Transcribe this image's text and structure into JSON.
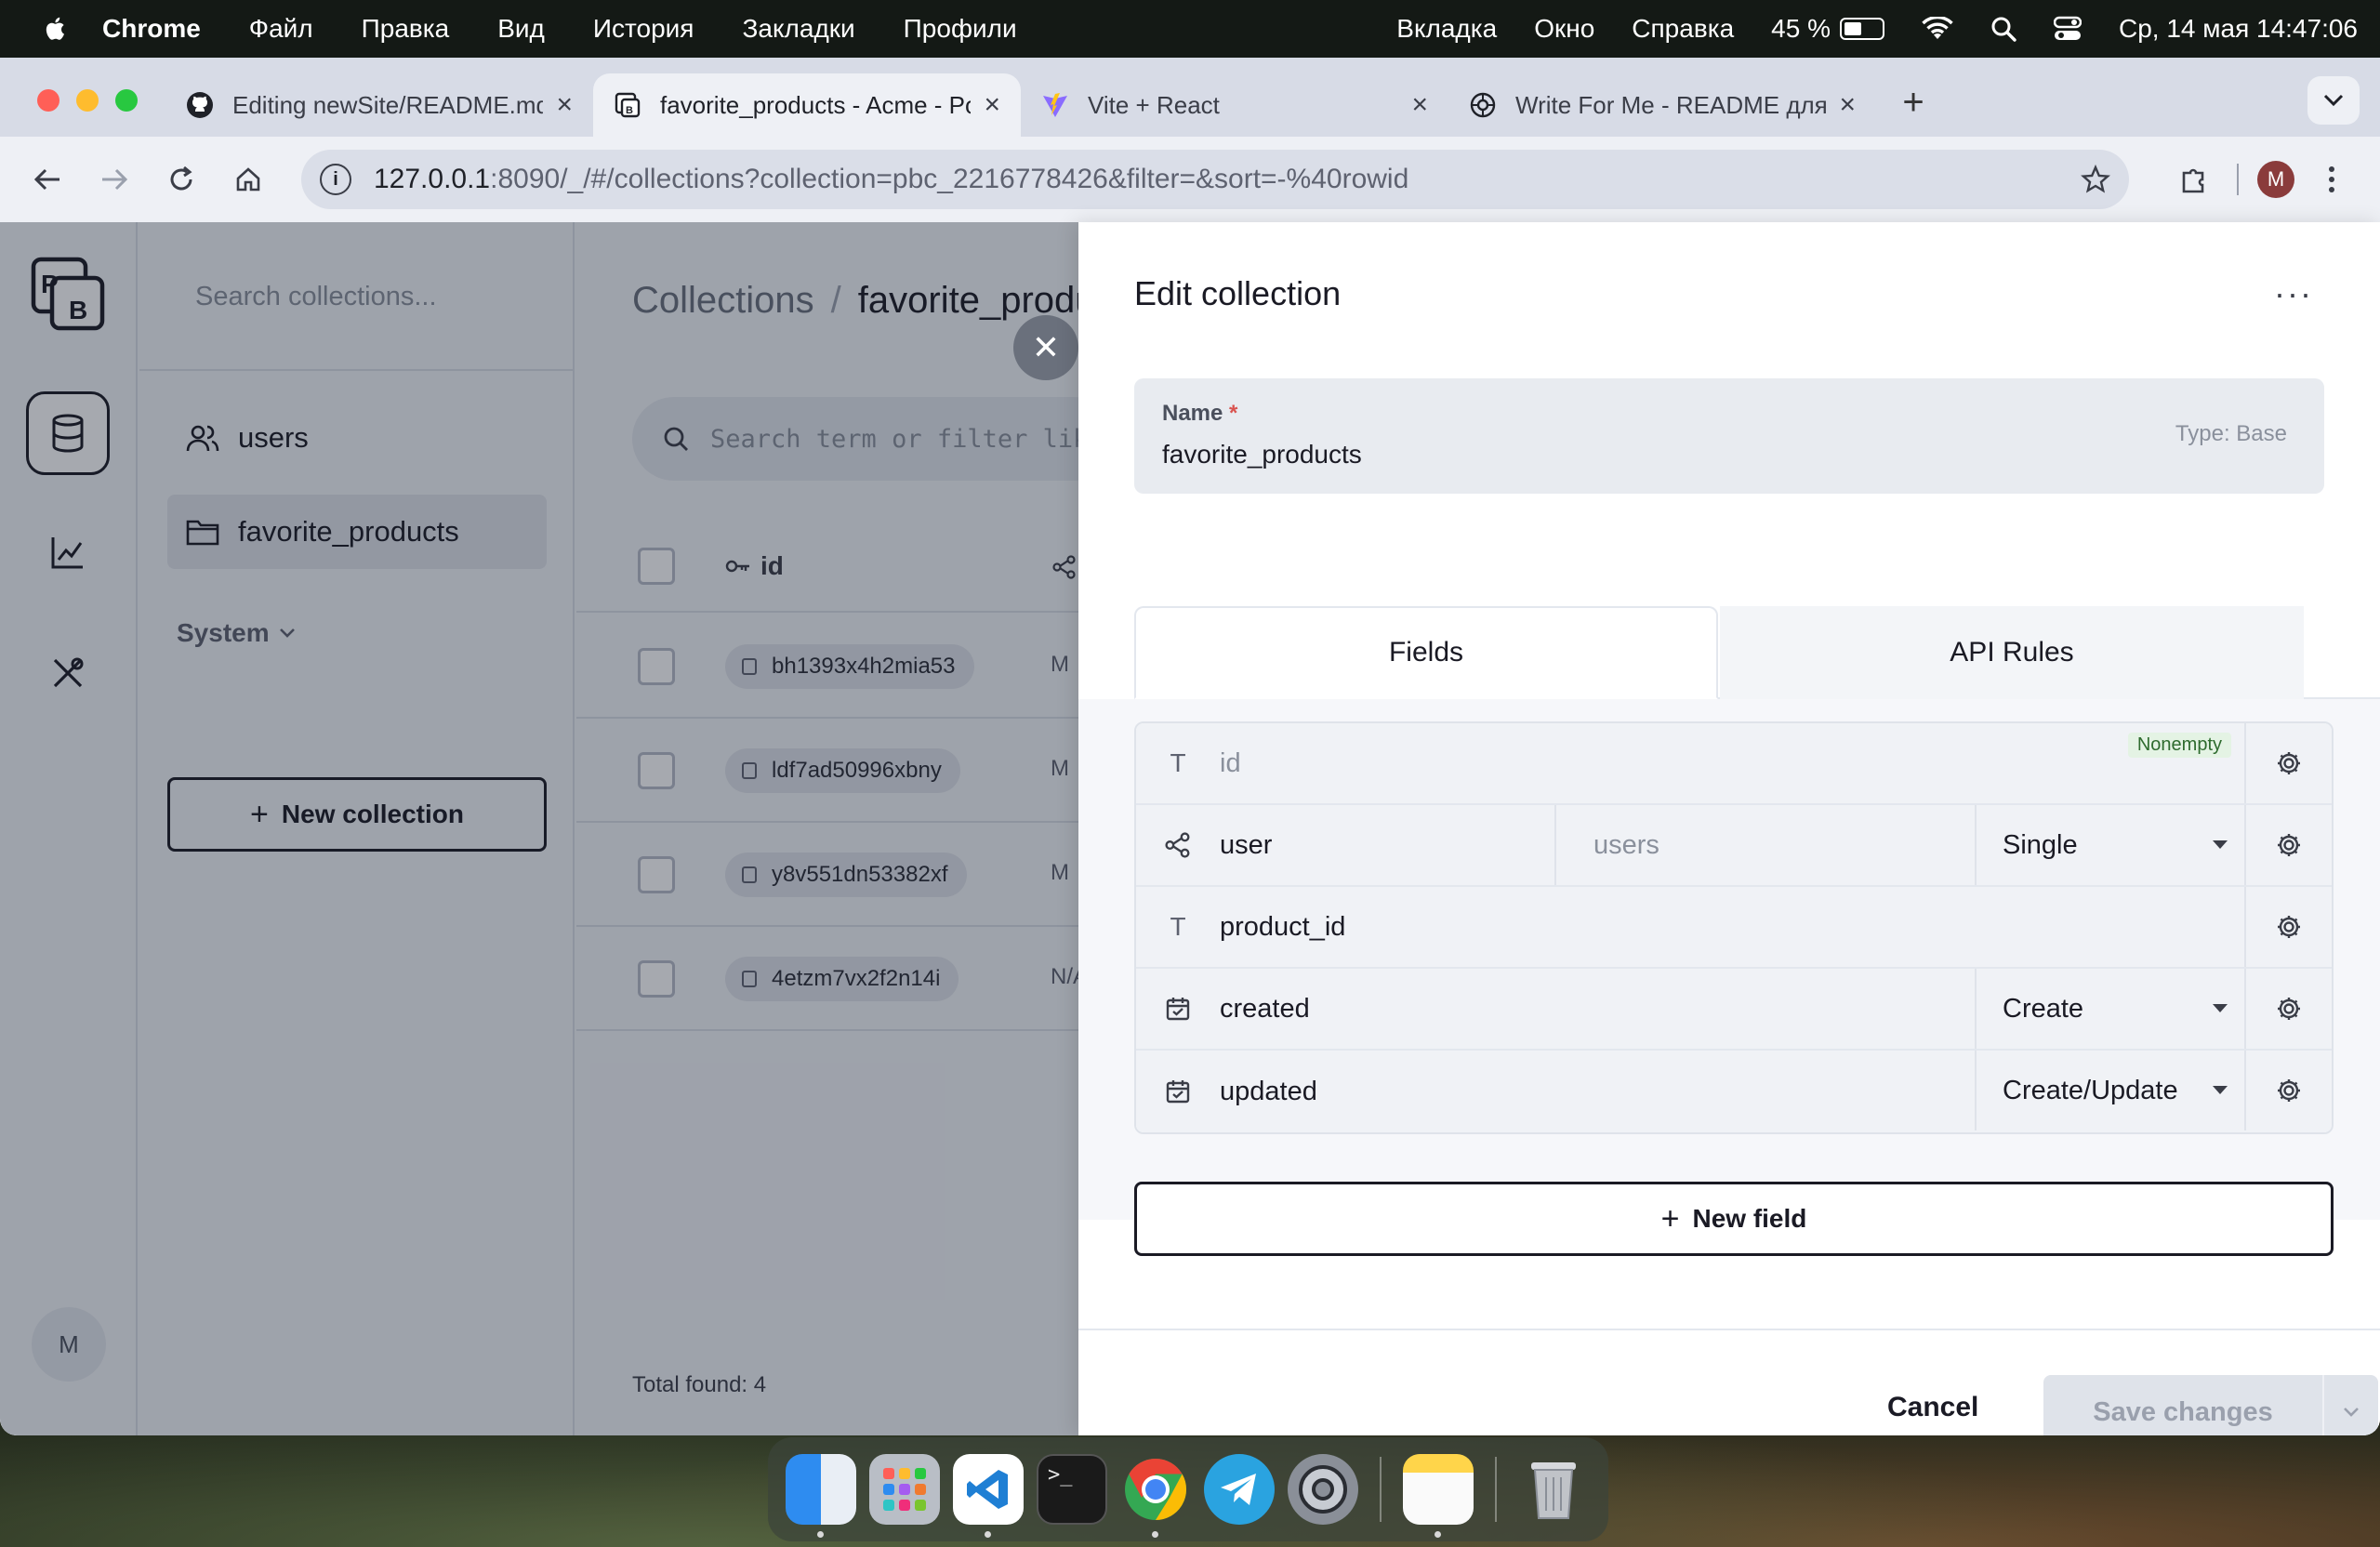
{
  "menubar": {
    "app": "Chrome",
    "items": [
      "Файл",
      "Правка",
      "Вид",
      "История",
      "Закладки",
      "Профили"
    ],
    "right_items": [
      "Вкладка",
      "Окно",
      "Справка"
    ],
    "battery": "45 %",
    "datetime": "Ср, 14 мая  14:47:06"
  },
  "browser": {
    "tabs": [
      {
        "title": "Editing newSite/README.md at",
        "icon": "github-icon"
      },
      {
        "title": "favorite_products - Acme - PocketBase",
        "icon": "pocketbase-icon"
      },
      {
        "title": "Vite + React",
        "icon": "vite-icon"
      },
      {
        "title": "Write For Me - README для про",
        "icon": "openai-icon"
      }
    ],
    "active_tab": 1,
    "url_host": "127.0.0.1",
    "url_rest": ":8090/_/#/collections?collection=pbc_2216778426&filter=&sort=-%40rowid",
    "profile_initial": "M"
  },
  "sidebar": {
    "search_placeholder": "Search collections...",
    "collections": [
      {
        "label": "users",
        "icon": "users-icon"
      },
      {
        "label": "favorite_products",
        "icon": "folder-icon"
      }
    ],
    "system_label": "System",
    "new_collection_label": "New collection",
    "avatar_initial": "M"
  },
  "main": {
    "breadcrumb_root": "Collections",
    "breadcrumb_current": "favorite_products",
    "search_placeholder": "Search term or filter like",
    "id_column": "id",
    "rows": [
      {
        "id": "bh1393x4h2mia53",
        "extra": "M"
      },
      {
        "id": "ldf7ad50996xbny",
        "extra": "M"
      },
      {
        "id": "y8v551dn53382xf",
        "extra": "M"
      },
      {
        "id": "4etzm7vx2f2n14i",
        "extra": "N/A"
      }
    ],
    "total_label": "Total found:",
    "total_count": "4"
  },
  "panel": {
    "title": "Edit collection",
    "more": "···",
    "name_label": "Name",
    "name_required": "*",
    "name_value": "favorite_products",
    "type_label": "Type: Base",
    "tabs": [
      "Fields",
      "API Rules"
    ],
    "fields": [
      {
        "name": "id",
        "icon": "text-icon",
        "badge": "Nonempty"
      },
      {
        "name": "user",
        "icon": "relation-icon",
        "relation": "users",
        "option": "Single"
      },
      {
        "name": "product_id",
        "icon": "text-icon"
      },
      {
        "name": "created",
        "icon": "calendar-icon",
        "option": "Create"
      },
      {
        "name": "updated",
        "icon": "calendar-icon",
        "option": "Create/Update"
      }
    ],
    "new_field_label": "New field",
    "cancel_label": "Cancel",
    "save_label": "Save changes"
  },
  "dock": {
    "apps": [
      "finder",
      "launchpad",
      "vscode",
      "terminal",
      "chrome",
      "telegram",
      "system-settings",
      "notes",
      "trash"
    ]
  },
  "colors": {
    "accent": "#1a1a24",
    "panel_bg": "#ffffff",
    "sidebar_bg": "#f3f5f8",
    "required": "#d9534f",
    "badge_green": "#2e6b2e"
  }
}
